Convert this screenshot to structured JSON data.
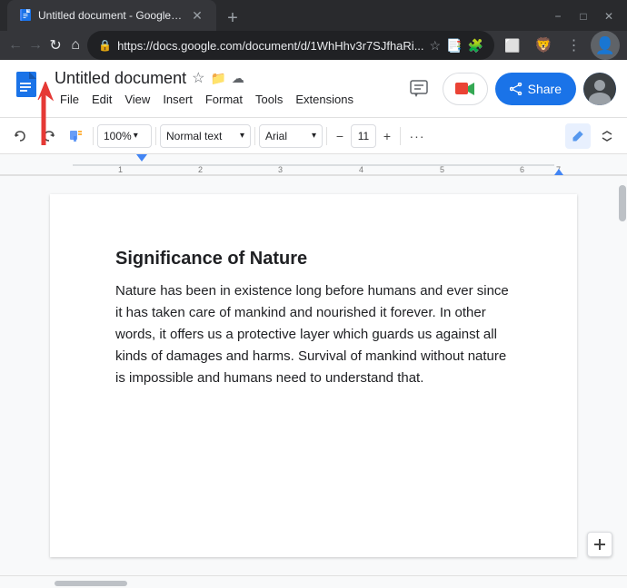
{
  "browser": {
    "tab": {
      "title": "Untitled document - Google Doc...",
      "favicon": "📄"
    },
    "url": "https://docs.google.com/document/d/1WhHhv3r7SJfhaRi...",
    "new_tab_icon": "+",
    "window_controls": {
      "minimize": "−",
      "maximize": "□",
      "close": "✕"
    },
    "nav": {
      "back": "←",
      "forward": "→",
      "refresh": "↻",
      "home": "⌂"
    }
  },
  "docs": {
    "title": "Untitled document",
    "menu_items": [
      "File",
      "Edit",
      "View",
      "Insert",
      "Format",
      "Tools",
      "Extensions"
    ],
    "toolbar": {
      "undo": "↩",
      "redo": "↪",
      "paint_format": "🖌",
      "zoom_value": "100%",
      "style_value": "Normal text",
      "font_value": "Arial",
      "font_size": "11",
      "more_options": "···",
      "edit_pencil": "✏"
    },
    "share_btn": "Share",
    "heading": "Significance of Nature",
    "paragraph": "Nature has been in existence long before humans and ever since it has taken care of mankind and nourished it forever. In other words, it offers us a protective layer which guards us against all kinds of damages and harms. Survival of mankind without nature is impossible and humans need to understand that."
  }
}
